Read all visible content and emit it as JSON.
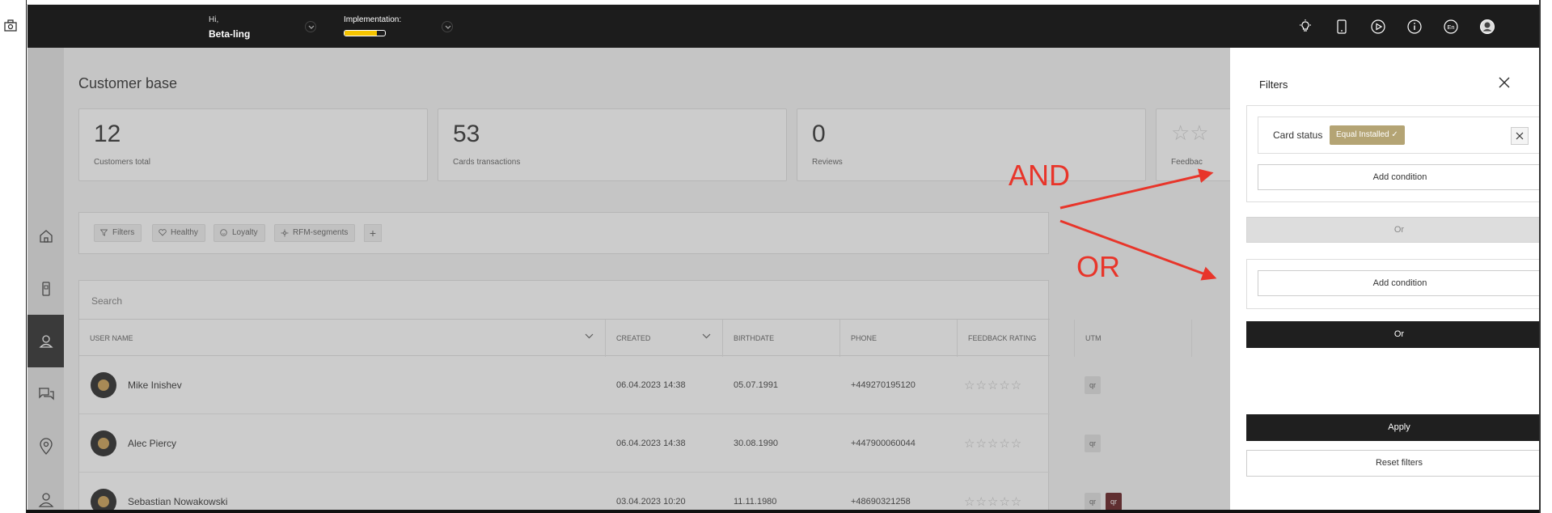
{
  "header": {
    "greeting": "Hi,",
    "user_name": "Beta-ling",
    "implementation_label": "Implementation:",
    "implementation_progress": 0.8,
    "icons": [
      "lightbulb-icon",
      "phone-icon",
      "play-icon",
      "info-icon",
      "language-icon",
      "avatar-icon"
    ],
    "language": "En"
  },
  "sidebar": {
    "items": [
      "home-icon",
      "device-icon",
      "customers-icon",
      "chat-icon",
      "location-icon",
      "profile-icon"
    ],
    "active": "customers-icon"
  },
  "page": {
    "title": "Customer base",
    "stats": [
      {
        "value": "12",
        "label": "Customers total"
      },
      {
        "value": "53",
        "label": "Cards transactions"
      },
      {
        "value": "0",
        "label": "Reviews"
      },
      {
        "value": "",
        "label": "Feedbac"
      }
    ],
    "chips": [
      "Filters",
      "Healthy",
      "Loyalty",
      "RFM-segments"
    ],
    "chip_add": "+",
    "search_placeholder": "Search",
    "columns": [
      "USER NAME",
      "CREATED",
      "BIRTHDATE",
      "PHONE",
      "FEEDBACK RATING",
      "UTM"
    ],
    "rows": [
      {
        "name": "Mike Inishev",
        "created": "06.04.2023 14:38",
        "birthdate": "05.07.1991",
        "phone": "+449270195120",
        "utm": [
          "qr"
        ]
      },
      {
        "name": "Alec Piercy",
        "created": "06.04.2023 14:38",
        "birthdate": "30.08.1990",
        "phone": "+447900060044",
        "utm": [
          "qr"
        ]
      },
      {
        "name": "Sebastian Nowakowski",
        "created": "03.04.2023 10:20",
        "birthdate": "11.11.1980",
        "phone": "+48690321258",
        "utm": [
          "qr",
          "qr"
        ]
      }
    ],
    "stars": "☆☆☆☆☆"
  },
  "filters": {
    "title": "Filters",
    "condition_label": "Card status",
    "condition_value": "Equal Installed",
    "add_condition": "Add condition",
    "or_disabled": "Or",
    "or_button": "Or",
    "apply": "Apply",
    "reset": "Reset filters"
  },
  "annotations": {
    "and": "AND",
    "or": "OR",
    "color": "#e8352a"
  }
}
